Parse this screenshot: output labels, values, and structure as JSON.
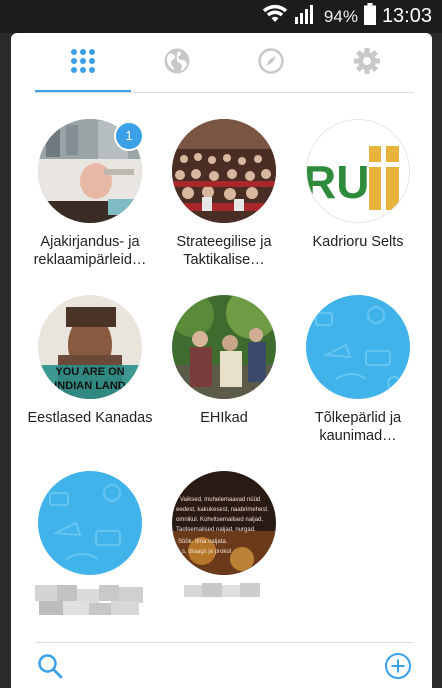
{
  "status_bar": {
    "battery_percent": "94%",
    "time": "13:03"
  },
  "tabs": [
    {
      "name": "grid",
      "icon": "grid-icon",
      "active": true
    },
    {
      "name": "globe",
      "icon": "globe-icon",
      "active": false
    },
    {
      "name": "explore",
      "icon": "compass-icon",
      "active": false
    },
    {
      "name": "settings",
      "icon": "gear-icon",
      "active": false
    }
  ],
  "groups": [
    {
      "label": "Ajakirjandus- ja reklaamipärleid…",
      "badge": "1"
    },
    {
      "label": "Strateegilise ja Taktikalise…"
    },
    {
      "label": "Kadrioru Selts",
      "logo_text": "RU"
    },
    {
      "label": "Eestlased Kanadas",
      "image_text": "YOU ARE ON INDIAN LAND"
    },
    {
      "label": "EHIkad"
    },
    {
      "label": "Tõlkepärlid ja kaunimad…"
    },
    {
      "label": ""
    },
    {
      "label": "",
      "image_text": "Vaiksed, muhelemaavad nüüd eedest, kakukesest, naabrimehest. omnikul. Kohvitsemalised naljad, Taotsemalised naljad, nurgad. Söök. Ilma naljata. s, draags ja prokol"
    }
  ],
  "colors": {
    "accent": "#3aa0e8",
    "tab_inactive": "#c8c8c8",
    "placeholder_blue": "#3fb3ea"
  },
  "bottom_bar": {
    "left_icon": "search-icon",
    "right_icon": "add-circle-icon"
  }
}
